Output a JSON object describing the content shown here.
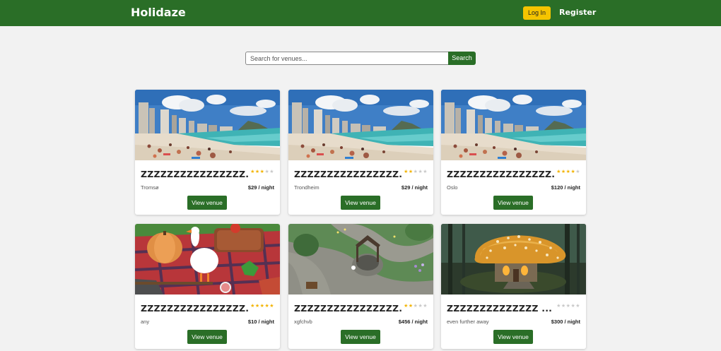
{
  "header": {
    "logo": "Holidaze",
    "login_label": "Log In",
    "register_label": "Register"
  },
  "search": {
    "placeholder": "Search for venues...",
    "value": "",
    "button_label": "Search"
  },
  "venues": [
    {
      "name": "ZZZZZZZZZZZZZZZZ...",
      "location": "Tromsø",
      "price": "$29 / night",
      "rating": 3,
      "image": "beach-photo",
      "button_label": "View venue"
    },
    {
      "name": "ZZZZZZZZZZZZZZZZ...",
      "location": "Trondheim",
      "price": "$29 / night",
      "rating": 2,
      "image": "beach-photo",
      "button_label": "View venue"
    },
    {
      "name": "ZZZZZZZZZZZZZZZZ...",
      "location": "Oslo",
      "price": "$120 / night",
      "rating": 4,
      "image": "beach-photo",
      "button_label": "View venue"
    },
    {
      "name": "ZZZZZZZZZZZZZZZZ...",
      "location": "any",
      "price": "$10 / night",
      "rating": 5,
      "image": "goose-picnic-illustration",
      "button_label": "View venue"
    },
    {
      "name": "ZZZZZZZZZZZZZZZZ...",
      "location": "xgfchvb",
      "price": "$456 / night",
      "rating": 2,
      "image": "garden-well-illustration",
      "button_label": "View venue"
    },
    {
      "name": "ZZZZZZZZZZZZZZ ...",
      "location": "even further away",
      "price": "$300 / night",
      "rating": 0,
      "image": "mushroom-house-illustration",
      "button_label": "View venue"
    }
  ],
  "colors": {
    "brand_green": "#2a6e27",
    "login_yellow": "#f5c400",
    "star_on": "#f3b400",
    "star_off": "#c9c9c9",
    "page_bg": "#f2f2f2"
  }
}
